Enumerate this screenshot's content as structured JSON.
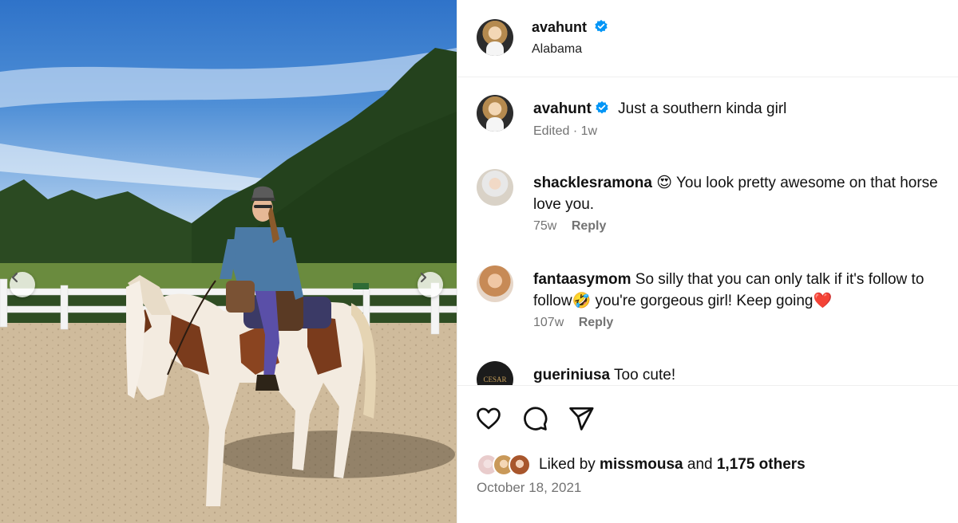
{
  "post": {
    "author": "avahunt",
    "location": "Alabama"
  },
  "caption": {
    "username": "avahunt",
    "text": "Just a southern kinda girl",
    "meta": "Edited · 1w"
  },
  "comments": [
    {
      "username": "shacklesramona",
      "text": " 😍 You look pretty awesome on that horse love you.",
      "age": "75w",
      "reply": "Reply"
    },
    {
      "username": "fantaasymom",
      "text": " So silly that you can only talk if it's follow to follow🤣 you're gorgeous girl! Keep going❤️",
      "age": "107w",
      "reply": "Reply"
    },
    {
      "username": "gueriniusa",
      "text": " Too cute!",
      "avatar_label": "CESAR"
    }
  ],
  "likes": {
    "prefix": "Liked by ",
    "user": "missmousa",
    "middle": " and ",
    "others": "1,175 others"
  },
  "date": "October 18, 2021",
  "colors": {
    "verified": "#0095f6",
    "secondary_text": "#737373",
    "divider": "#efefef"
  },
  "icons": [
    "chevron-left-icon",
    "chevron-right-icon",
    "verified-badge-icon",
    "heart-icon",
    "comment-icon",
    "share-icon"
  ]
}
